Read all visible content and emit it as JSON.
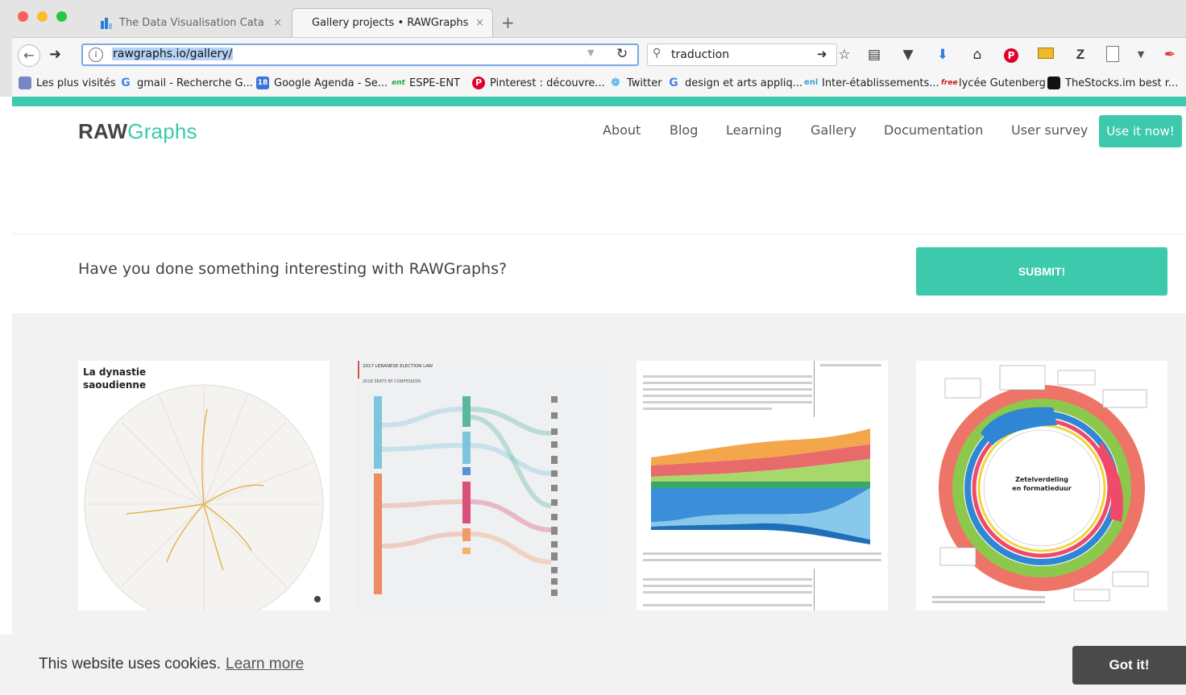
{
  "browser": {
    "tabs": [
      {
        "title": "The Data Visualisation Catalog",
        "active": false
      },
      {
        "title": "Gallery projects • RAWGraphs",
        "active": true
      }
    ],
    "new_tab": "+",
    "close_glyph": "×",
    "url": "rawgraphs.io/gallery/",
    "search_value": "traduction",
    "bookmarks": [
      {
        "label": "Les plus visités",
        "icon": "folder-icon"
      },
      {
        "label": "gmail - Recherche G...",
        "icon": "google-icon"
      },
      {
        "label": "Google Agenda - Se...",
        "icon": "calendar-icon",
        "badge": "18"
      },
      {
        "label": "ESPE-ENT",
        "icon": "ent-icon",
        "badge": "ent"
      },
      {
        "label": "Pinterest : découvre...",
        "icon": "pinterest-icon"
      },
      {
        "label": "Twitter",
        "icon": "twitter-icon"
      },
      {
        "label": "design et arts appliq...",
        "icon": "google-icon"
      },
      {
        "label": "Inter-établissements...",
        "icon": "ent-icon",
        "badge": "enl"
      },
      {
        "label": "lycée Gutenberg",
        "icon": "free-icon",
        "badge": "free"
      },
      {
        "label": "TheStocks.im best r...",
        "icon": "thestocks-icon"
      }
    ]
  },
  "site": {
    "logo_bold": "RAW",
    "logo_light": "Graphs",
    "nav": [
      "About",
      "Blog",
      "Learning",
      "Gallery",
      "Documentation",
      "User survey"
    ],
    "cta": "Use it now!",
    "banner_text": "Have you done something interesting with RAWGraphs?",
    "submit": "SUBMIT!",
    "gallery_cards": [
      {
        "title": "La dynastie saoudienne",
        "chart": "radial-dendrogram"
      },
      {
        "title": "2017 LEBANESE ELECTION LAW",
        "subtitle": "2018 SEATS BY CONFESSION",
        "chart": "alluvial"
      },
      {
        "title": "",
        "chart": "streamgraph"
      },
      {
        "title": "Zetelverdeling en formatieduur",
        "chart": "circular-streamgraph"
      }
    ],
    "cookie_text": "This website uses cookies.",
    "cookie_link": "Learn more",
    "cookie_button": "Got it!"
  },
  "colors": {
    "accent": "#3dc9ac",
    "dark": "#4a4a4a"
  }
}
